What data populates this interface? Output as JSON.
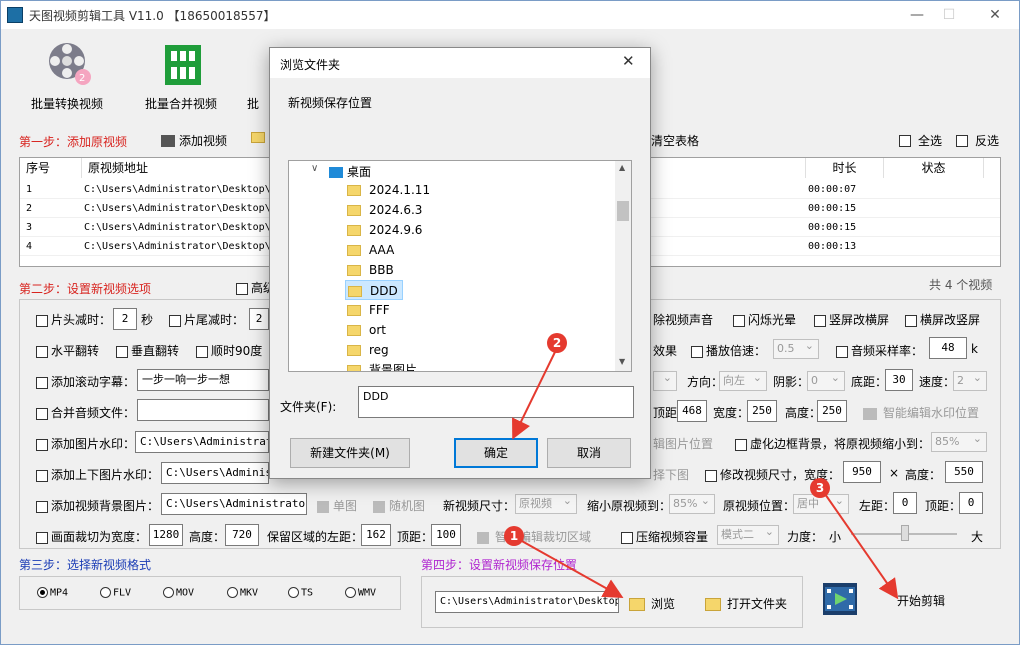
{
  "app": {
    "title": "天图视频剪辑工具 V11.0 【18650018557】"
  },
  "toolbar": {
    "tools": [
      "批量转换视频",
      "批量合并视频",
      "批"
    ]
  },
  "step1": {
    "label": "第一步：添加原视频",
    "add_video": "添加视频",
    "clear_table": "清空表格",
    "select_all": "全选",
    "invert": "反选"
  },
  "table": {
    "headers": [
      "序号",
      "原视频地址",
      "时长",
      "状态"
    ],
    "rows": [
      {
        "n": "1",
        "path": "C:\\Users\\Administrator\\Desktop\\",
        "dur": "00:00:07"
      },
      {
        "n": "2",
        "path": "C:\\Users\\Administrator\\Desktop\\",
        "dur": "00:00:15"
      },
      {
        "n": "3",
        "path": "C:\\Users\\Administrator\\Desktop\\",
        "dur": "00:00:15"
      },
      {
        "n": "4",
        "path": "C:\\Users\\Administrator\\Desktop\\",
        "dur": "00:00:13"
      }
    ],
    "total": "共 4 个视频"
  },
  "step2": {
    "label": "第二步：设置新视频选项",
    "advanced": "高级"
  },
  "options": {
    "head_cut": "片头减时：",
    "head_val": "2",
    "sec": "秒",
    "tail_cut": "片尾减时：",
    "tail_val": "2",
    "remove_audio": "除视频声音",
    "flash": "闪烁光晕",
    "v2h": "竖屏改横屏",
    "h2v": "横屏改竖屏",
    "hflip": "水平翻转",
    "vflip": "垂直翻转",
    "rot90": "顺时90度",
    "effect": "效果",
    "playback": "播放倍速：",
    "playback_val": "0.5",
    "sample_rate": "音频采样率：",
    "sample_val": "48",
    "k": "k",
    "scroll_sub": "添加滚动字幕：",
    "scroll_text": "一步一响一步一想",
    "direction": "方向：",
    "direction_val": "向左",
    "shadow": "阴影：",
    "shadow_val": "0",
    "bottom": "底距：",
    "bottom_val": "30",
    "speed": "速度：",
    "speed_val": "2",
    "merge_audio": "合并音频文件：",
    "wm_top_label": "顶距：",
    "wm_top_val": "468",
    "wm_w_label": "宽度：",
    "wm_w_val": "250",
    "wm_h_label": "高度：",
    "wm_h_val": "250",
    "smart_wm": "智能编辑水印位置",
    "img_wm": "添加图片水印：",
    "img_wm_path": "C:\\Users\\Administrator",
    "edit_img_pos": "辑图片位置",
    "blur_border": "虚化边框背景，将原视频缩小到：",
    "blur_val": "85%",
    "tb_img_wm": "添加上下图片水印：",
    "tb_img_path": "C:\\Users\\Administrator",
    "pick_img": "择下图",
    "resize": "修改视频尺寸，宽度：",
    "resize_w": "950",
    "times": "×",
    "resize_h_label": "高度：",
    "resize_h": "550",
    "bg_img": "添加视频背景图片：",
    "bg_img_path": "C:\\Users\\Administrator\\D",
    "single": "单图",
    "random": "随机图",
    "new_size": "新视频尺寸：",
    "new_size_val": "原视频",
    "shrink": "缩小原视频到：",
    "shrink_val": "85%",
    "pos": "原视频位置：",
    "pos_val": "居中",
    "left": "左距：",
    "left_val": "0",
    "top": "顶距：",
    "top_val": "0",
    "crop": "画面裁切为宽度：",
    "crop_w": "1280",
    "crop_h_label": "高度：",
    "crop_h": "720",
    "keep_left": "保留区域的左距：",
    "keep_left_val": "162",
    "keep_top": "顶距：",
    "keep_top_val": "100",
    "smart_crop": "智能编辑裁切区域",
    "compress": "压缩视频容量",
    "compress_mode": "模式二",
    "strength": "力度：",
    "small": "小",
    "big": "大"
  },
  "step3": {
    "label": "第三步：选择新视频格式",
    "formats": [
      "MP4",
      "FLV",
      "MOV",
      "MKV",
      "TS",
      "WMV"
    ]
  },
  "step4": {
    "label": "第四步：设置新视频保存位置",
    "path": "C:\\Users\\Administrator\\Desktop",
    "browse": "浏览",
    "open_folder": "打开文件夹",
    "start": "开始剪辑"
  },
  "dialog": {
    "title": "浏览文件夹",
    "caption": "新视频保存位置",
    "root": "桌面",
    "folders": [
      "2024.1.11",
      "2024.6.3",
      "2024.9.6",
      "AAA",
      "BBB",
      "DDD",
      "FFF",
      "ort",
      "reg",
      "背景图片"
    ],
    "folder_label": "文件夹(F):",
    "folder_value": "DDD",
    "new_folder": "新建文件夹(M)",
    "ok": "确定",
    "cancel": "取消"
  },
  "markers": [
    "1",
    "2",
    "3"
  ],
  "colors": {
    "step_red": "#d8241f",
    "step_purple": "#b026d0",
    "step_blue": "#1a3cb5",
    "arrow": "#e53a2f",
    "selection": "#cce8ff"
  }
}
